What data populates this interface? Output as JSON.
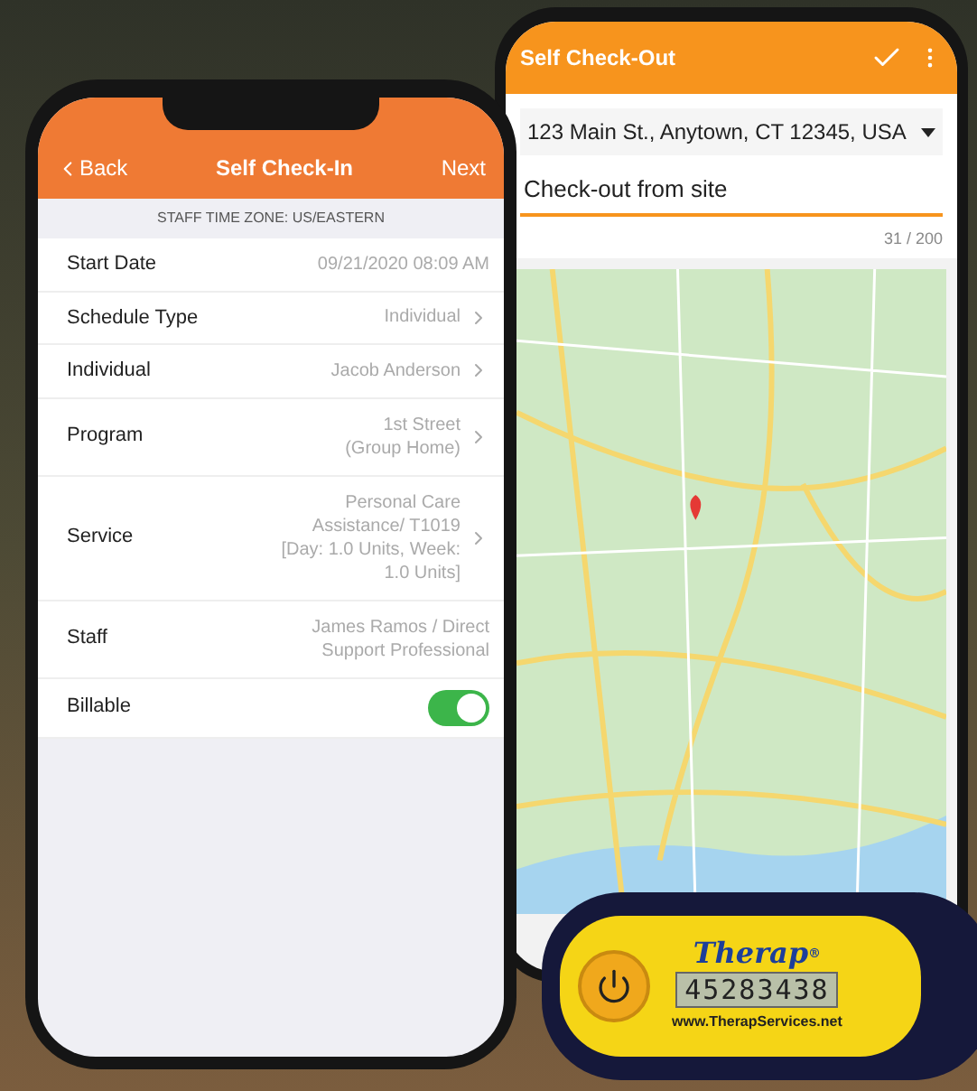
{
  "check_in": {
    "title": "Self Check-In",
    "back": "Back",
    "next": "Next",
    "timezone": "STAFF TIME ZONE: US/EASTERN",
    "rows": [
      {
        "kind": "value",
        "label": "Start Date",
        "value": "09/21/2020 08:09 AM"
      },
      {
        "kind": "link",
        "label": "Schedule Type",
        "value": "Individual"
      },
      {
        "kind": "link",
        "label": "Individual",
        "value": "Jacob Anderson"
      },
      {
        "kind": "link",
        "label": "Program",
        "value": "1st Street\n(Group Home)"
      },
      {
        "kind": "link",
        "label": "Service",
        "value": "Personal Care\nAssistance/ T1019\n[Day:  1.0 Units, Week:\n1.0 Units]"
      },
      {
        "kind": "value",
        "label": "Staff",
        "value": "James Ramos / Direct\nSupport Professional"
      },
      {
        "kind": "toggle",
        "label": "Billable",
        "on": true
      }
    ]
  },
  "check_out": {
    "title": "Self Check-Out",
    "address": "123 Main St., Anytown, CT 12345, USA",
    "note": "Check-out from site",
    "counter": "31 / 200"
  },
  "token": {
    "brand": "Therap",
    "registered": "®",
    "code": "45283438",
    "url": "www.TherapServices.net"
  }
}
